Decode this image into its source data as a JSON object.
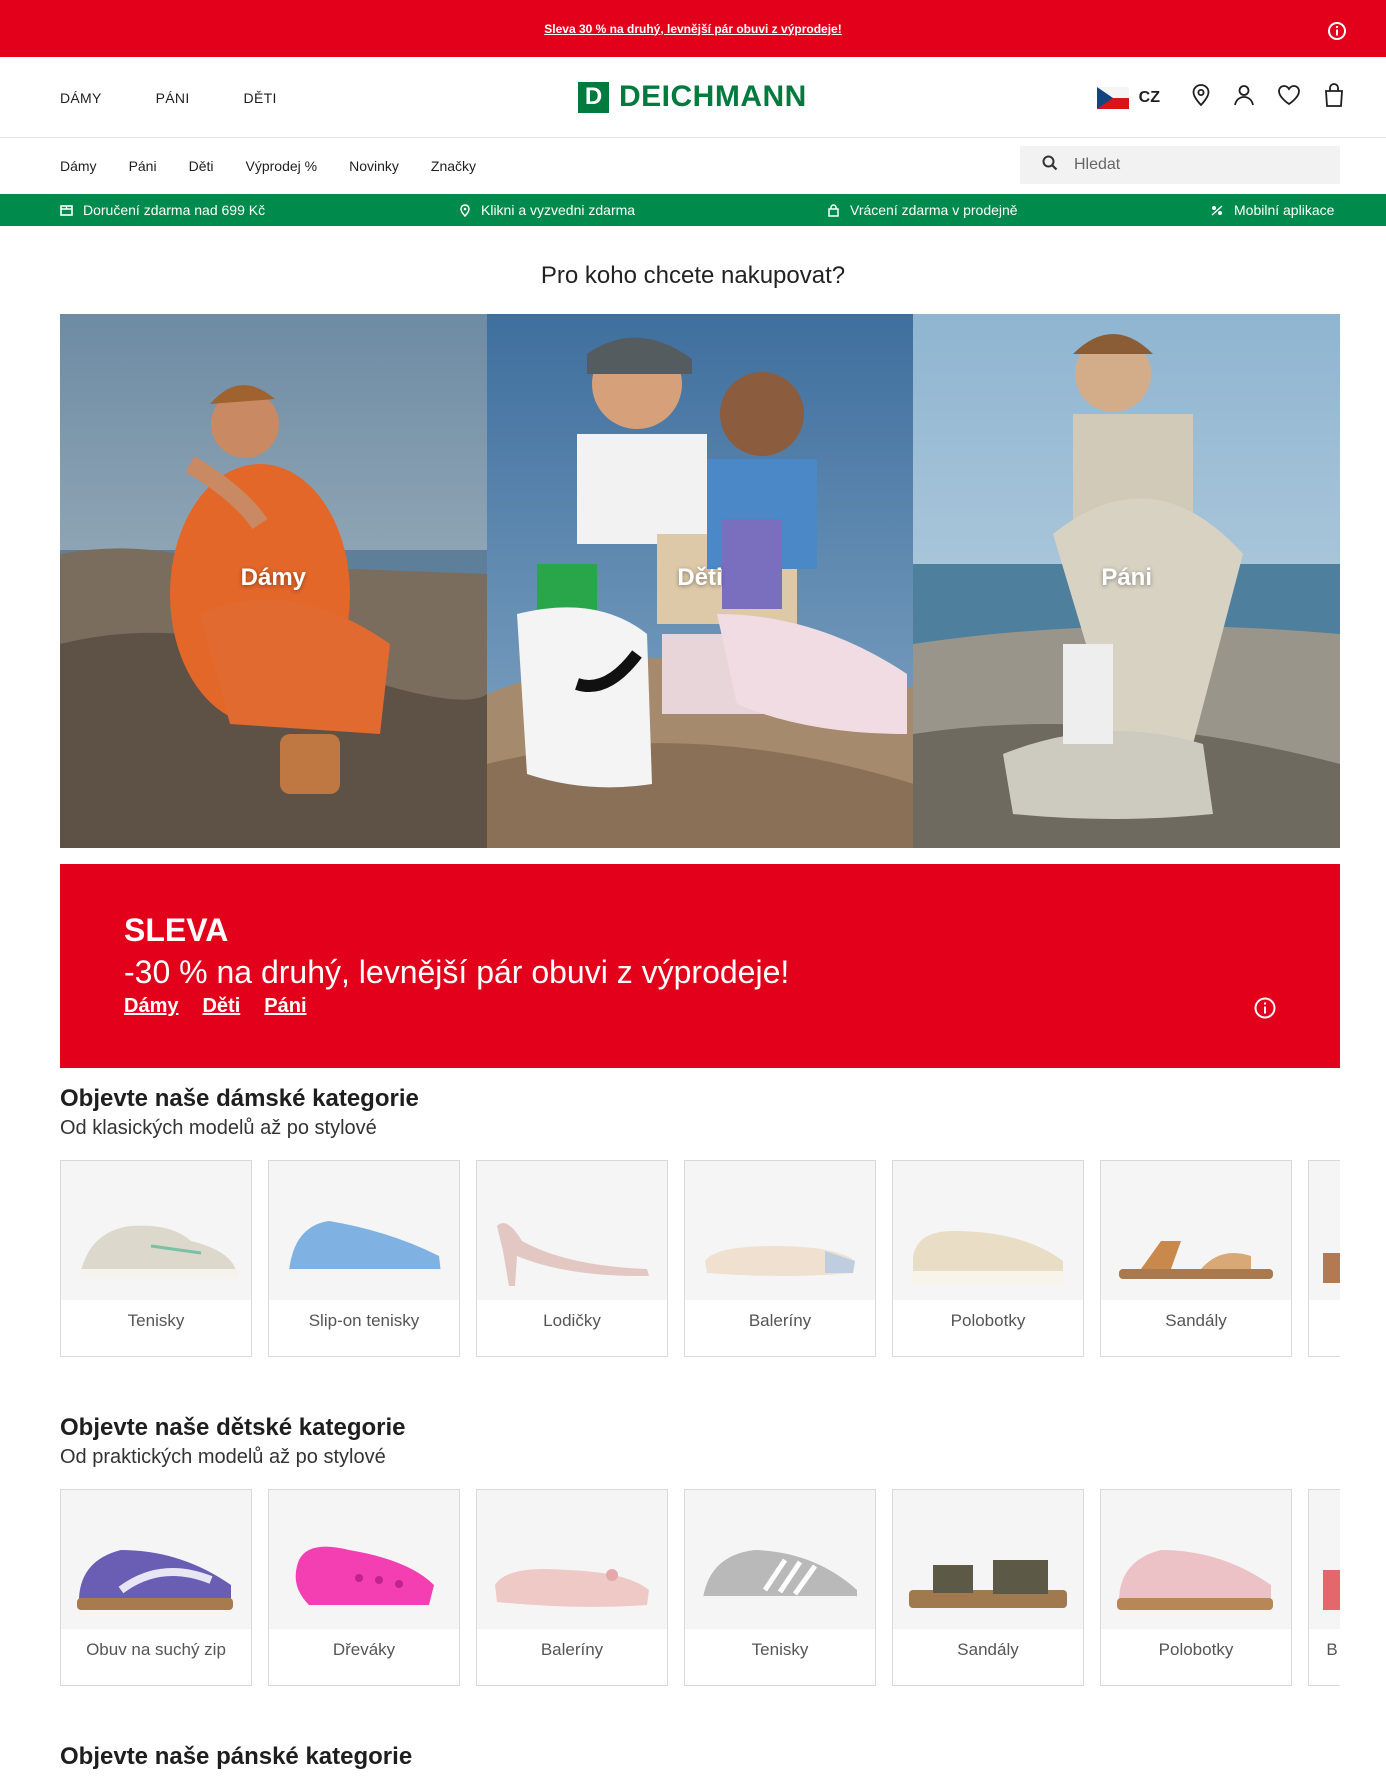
{
  "promo_bar": {
    "text": "Sleva 30 % na druhý, levnější pár obuvi z výprodeje!"
  },
  "header": {
    "gender_nav": [
      "DÁMY",
      "PÁNI",
      "DĚTI"
    ],
    "logo_text": "DEICHMANN",
    "logo_mark": "D",
    "country": "CZ"
  },
  "subnav": {
    "links": [
      "Dámy",
      "Páni",
      "Děti",
      "Výprodej %",
      "Novinky",
      "Značky"
    ],
    "search_placeholder": "Hledat"
  },
  "usp": [
    "Doručení zdarma nad 699 Kč",
    "Klikni a vyzvedni zdarma",
    "Vrácení zdarma v prodejně",
    "Mobilní aplikace"
  ],
  "hero": {
    "title": "Pro koho chcete nakupovat?",
    "tiles": [
      "Dámy",
      "Děti",
      "Páni"
    ]
  },
  "sale_banner": {
    "heading": "SLEVA",
    "text": "-30 % na druhý, levnější pár obuvi z výprodeje!",
    "links": [
      "Dámy",
      "Děti",
      "Páni"
    ]
  },
  "women_section": {
    "title": "Objevte naše dámské kategorie",
    "subtitle": "Od klasických modelů až po stylové",
    "cards": [
      "Tenisky",
      "Slip-on tenisky",
      "Lodičky",
      "Baleríny",
      "Polobotky",
      "Sandály",
      ""
    ]
  },
  "kids_section": {
    "title": "Objevte naše dětské kategorie",
    "subtitle": "Od praktických modelů až po stylové",
    "cards": [
      "Obuv na suchý zip",
      "Dřeváky",
      "Baleríny",
      "Tenisky",
      "Sandály",
      "Polobotky",
      "B"
    ]
  },
  "men_section": {
    "title": "Objevte naše pánské kategorie"
  },
  "colors": {
    "brand_red": "#e2001a",
    "brand_green": "#007a3d",
    "usp_green": "#008a4b"
  }
}
